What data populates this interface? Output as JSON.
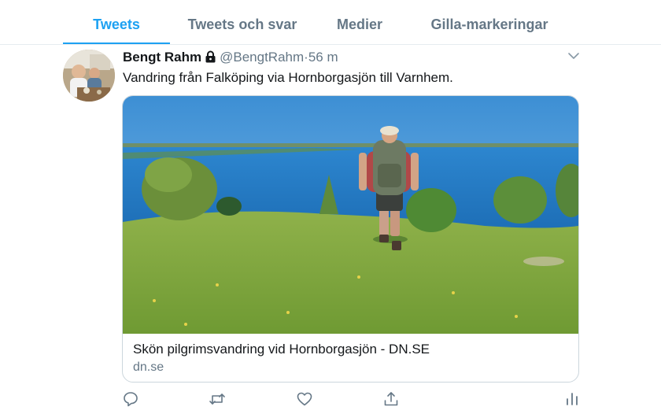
{
  "tabs": [
    {
      "label": "Tweets",
      "active": true
    },
    {
      "label": "Tweets och svar",
      "active": false
    },
    {
      "label": "Medier",
      "active": false
    },
    {
      "label": "Gilla-markeringar",
      "active": false
    }
  ],
  "tweet": {
    "display_name": "Bengt Rahm",
    "protected_icon": "lock-icon",
    "handle": "@BengtRahm",
    "separator": "·",
    "time": "56 m",
    "text": "Vandring från Falköping via Hornborgasjön till Varnhem.",
    "card": {
      "title": "Skön pilgrimsvandring vid Hornborgasjön - DN.SE",
      "domain": "dn.se"
    },
    "actions": [
      "reply-icon",
      "retweet-icon",
      "like-icon",
      "share-icon",
      "analytics-icon"
    ]
  },
  "colors": {
    "accent": "#1da1f2",
    "secondary_text": "#657786",
    "primary_text": "#14171a",
    "border": "#ccd6dd"
  }
}
